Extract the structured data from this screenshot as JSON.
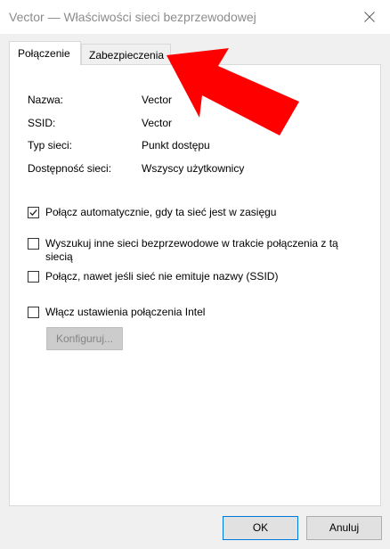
{
  "window": {
    "title": "Vector — Właściwości sieci bezprzewodowej"
  },
  "tabs": [
    {
      "label": "Połączenie",
      "active": true
    },
    {
      "label": "Zabezpieczenia",
      "active": false
    }
  ],
  "info": [
    {
      "label": "Nazwa:",
      "value": "Vector"
    },
    {
      "label": "SSID:",
      "value": "Vector"
    },
    {
      "label": "Typ sieci:",
      "value": "Punkt dostępu"
    },
    {
      "label": "Dostępność sieci:",
      "value": "Wszyscy użytkownicy"
    }
  ],
  "options": [
    {
      "label": "Połącz automatycznie, gdy ta sieć jest w zasięgu",
      "checked": true
    },
    {
      "label": "Wyszukuj inne sieci bezprzewodowe w trakcie połączenia z tą siecią",
      "checked": false
    },
    {
      "label": "Połącz, nawet jeśli sieć nie emituje nazwy (SSID)",
      "checked": false
    },
    {
      "label": "Włącz ustawienia połączenia Intel",
      "checked": false
    }
  ],
  "configure_label": "Konfiguruj...",
  "footer": {
    "ok_label": "OK",
    "cancel_label": "Anuluj"
  },
  "colors": {
    "annotation_arrow": "#ff0000",
    "accent": "#0078d7"
  },
  "icons": {
    "close": "close-icon",
    "check": "checkmark-icon"
  }
}
